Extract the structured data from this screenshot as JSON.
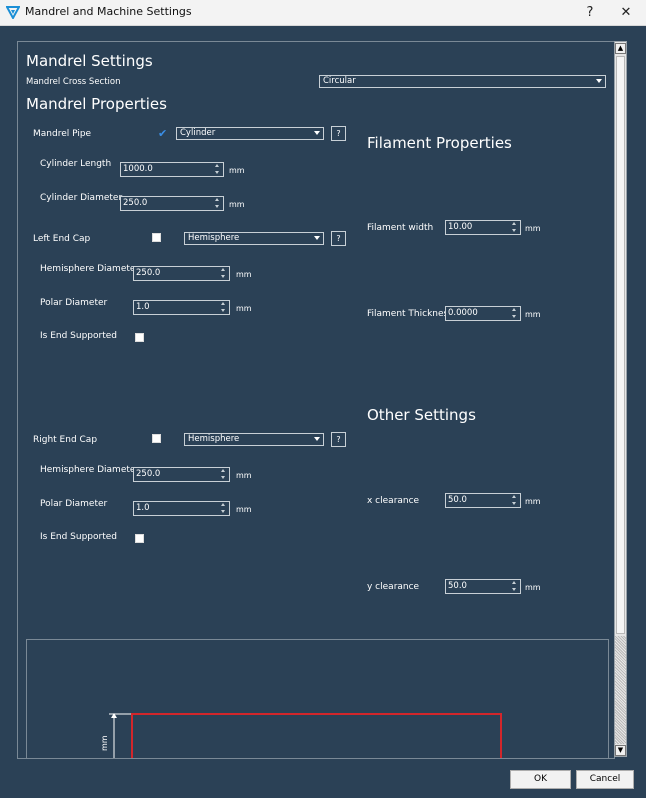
{
  "window": {
    "title": "Mandrel and Machine Settings",
    "help_label": "?",
    "close_label": "✕"
  },
  "mandrel_settings": {
    "heading": "Mandrel Settings",
    "cross_section_label": "Mandrel Cross Section",
    "cross_section_value": "Circular"
  },
  "mandrel_properties": {
    "heading": "Mandrel Properties",
    "pipe": {
      "label": "Mandrel Pipe",
      "checked": true,
      "type": "Cylinder",
      "help": "?",
      "length_label": "Cylinder Length",
      "length_value": "1000.0",
      "diameter_label": "Cylinder Diameter",
      "diameter_value": "250.0",
      "unit": "mm"
    },
    "left_cap": {
      "label": "Left End Cap",
      "checked": false,
      "type": "Hemisphere",
      "help": "?",
      "hemi_diameter_label": "Hemisphere Diameter",
      "hemi_diameter_value": "250.0",
      "polar_diameter_label": "Polar Diameter",
      "polar_diameter_value": "1.0",
      "supported_label": "Is End Supported",
      "unit": "mm"
    },
    "right_cap": {
      "label": "Right End Cap",
      "checked": false,
      "type": "Hemisphere",
      "help": "?",
      "hemi_diameter_label": "Hemisphere Diameter",
      "hemi_diameter_value": "250.0",
      "polar_diameter_label": "Polar Diameter",
      "polar_diameter_value": "1.0",
      "supported_label": "Is End Supported",
      "unit": "mm"
    }
  },
  "filament_properties": {
    "heading": "Filament Properties",
    "width_label": "Filament width",
    "width_value": "10.00",
    "thickness_label": "Filament Thickness",
    "thickness_value": "0.0000",
    "unit": "mm"
  },
  "other_settings": {
    "heading": "Other Settings",
    "x_label": "x clearance",
    "x_value": "50.0",
    "y_label": "y clearance",
    "y_value": "50.0",
    "unit": "mm"
  },
  "preview": {
    "dimension_label": "mm"
  },
  "buttons": {
    "ok": "OK",
    "cancel": "Cancel"
  },
  "colors": {
    "background": "#2b4156",
    "accent": "#3a8ee6",
    "preview_outline": "#d3262b"
  }
}
